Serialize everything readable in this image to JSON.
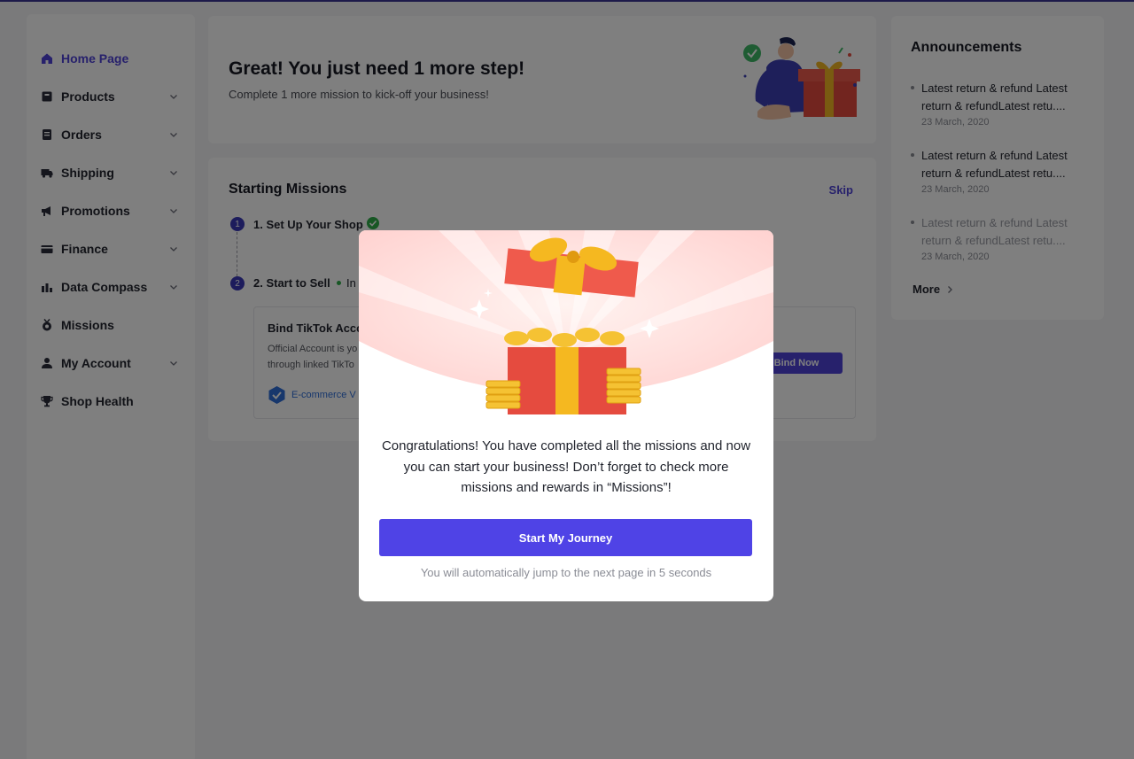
{
  "sidebar": {
    "items": [
      {
        "label": "Home Page",
        "icon": "home-icon",
        "active": true,
        "has_chevron": false
      },
      {
        "label": "Products",
        "icon": "product-box-icon",
        "has_chevron": true
      },
      {
        "label": "Orders",
        "icon": "orders-document-icon",
        "has_chevron": true
      },
      {
        "label": "Shipping",
        "icon": "truck-icon",
        "has_chevron": true
      },
      {
        "label": "Promotions",
        "icon": "megaphone-icon",
        "has_chevron": true
      },
      {
        "label": "Finance",
        "icon": "credit-card-icon",
        "has_chevron": true
      },
      {
        "label": "Data Compass",
        "icon": "bar-chart-icon",
        "has_chevron": true
      },
      {
        "label": "Missions",
        "icon": "medal-icon",
        "has_chevron": false
      },
      {
        "label": "My Account",
        "icon": "user-icon",
        "has_chevron": true
      },
      {
        "label": "Shop Health",
        "icon": "trophy-icon",
        "has_chevron": false
      }
    ]
  },
  "welcome": {
    "title": "Great! You just need 1 more step!",
    "subtitle": "Complete 1 more mission to kick-off your business!"
  },
  "missions": {
    "title": "Starting Missions",
    "skip_label": "Skip",
    "steps": [
      {
        "number": "1",
        "label": "1. Set Up Your Shop",
        "status": "completed"
      },
      {
        "number": "2",
        "label": "2. Start to Sell",
        "status_text": "In"
      }
    ],
    "bind_card": {
      "title": "Bind TikTok Acco",
      "desc_line1": "Official Account is yo",
      "desc_line2": "through linked TikTo",
      "badge": "E-commerce V",
      "button_label": "Bind Now"
    }
  },
  "announcements": {
    "title": "Announcements",
    "items": [
      {
        "text": "Latest return & refund Latest return & refundLatest retu....",
        "date": "23 March, 2020"
      },
      {
        "text": "Latest return & refund Latest return & refundLatest retu....",
        "date": "23 March, 2020"
      },
      {
        "text": "Latest return & refund Latest return & refundLatest retu....",
        "date": "23 March, 2020"
      }
    ],
    "more_label": "More"
  },
  "modal": {
    "message": "Congratulations! You have completed all the missions and now you can start your business! Don’t forget to check more missions and rewards in “Missions”!",
    "button_label": "Start My Journey",
    "note": "You will automatically jump to the next page in 5 seconds"
  },
  "colors": {
    "accent": "#4f43d8",
    "step_badge": "#3b39b8",
    "success": "#2fae49",
    "overlay": "rgba(0,0,0,0.5)"
  }
}
